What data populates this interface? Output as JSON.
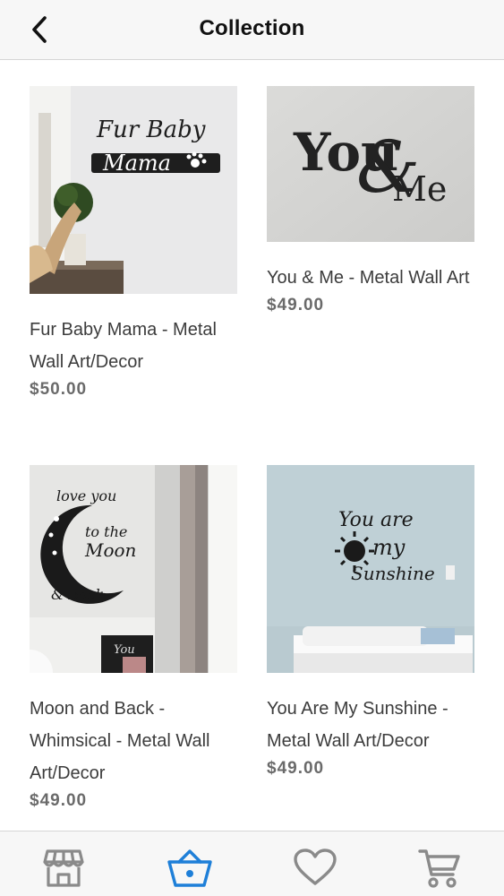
{
  "header": {
    "title": "Collection",
    "back_icon": "chevron-left-icon"
  },
  "products": [
    {
      "name": "Fur Baby Mama - Metal Wall Art/Decor",
      "price": "$50.00",
      "image_lettering": [
        "Fur Baby",
        "Mama"
      ]
    },
    {
      "name": "You & Me - Metal Wall Art",
      "price": "$49.00",
      "image_lettering": [
        "You",
        "&",
        "Me"
      ]
    },
    {
      "name": "Moon and Back - Whimsical - Metal Wall Art/Decor",
      "price": "$49.00",
      "image_lettering": [
        "love you",
        "to the",
        "Moon",
        "& Back",
        "You"
      ]
    },
    {
      "name": "You Are My Sunshine - Metal Wall Art/Decor",
      "price": "$49.00",
      "image_lettering": [
        "You are",
        "my",
        "Sunshine"
      ]
    }
  ],
  "tabbar": {
    "items": [
      {
        "icon": "store-icon",
        "active": false
      },
      {
        "icon": "basket-icon",
        "active": true
      },
      {
        "icon": "heart-icon",
        "active": false
      },
      {
        "icon": "cart-icon",
        "active": false
      }
    ],
    "active_color": "#1e7fd8",
    "inactive_color": "#8a8a8a"
  },
  "colors": {
    "header_bg": "#f7f7f7",
    "price": "#6a6a6a",
    "text": "#3c3c3c"
  }
}
